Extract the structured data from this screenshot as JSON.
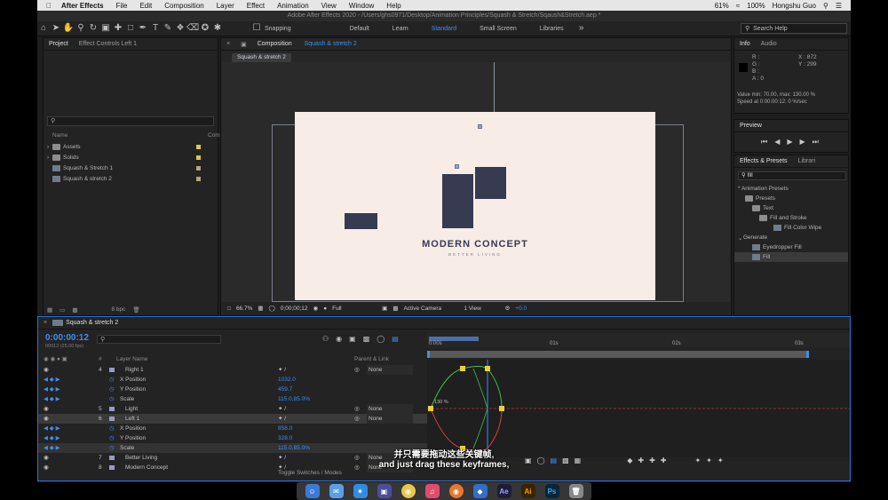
{
  "menubar": {
    "app": "After Effects",
    "items": [
      "File",
      "Edit",
      "Composition",
      "Layer",
      "Effect",
      "Animation",
      "View",
      "Window",
      "Help"
    ],
    "battery": "61%",
    "zoom": "100%",
    "user": "Hongshu Guo"
  },
  "titlebar": {
    "title": "Adobe After Effects 2020 - /Users/ghs0971/Desktop/Animation Principles/Squash & Stretch/Sqaush&Stretch.aep *"
  },
  "toolbar": {
    "snapping": "Snapping",
    "workspaces": [
      "Default",
      "Learn",
      "Standard",
      "Small Screen",
      "Libraries"
    ],
    "active_workspace": "Standard",
    "search_placeholder": "Search Help"
  },
  "project": {
    "tab_project": "Project",
    "tab_effect": "Effect Controls Left 1",
    "col_name": "Name",
    "col_comment": "Comm",
    "items": [
      {
        "name": "Assets",
        "type": "folder",
        "color": "#e0c54a"
      },
      {
        "name": "Solids",
        "type": "folder",
        "color": "#e0c54a"
      },
      {
        "name": "Squash & Stretch 1",
        "type": "comp",
        "color": "#b6a27c"
      },
      {
        "name": "Squash & stretch 2",
        "type": "comp",
        "color": "#b6a27c"
      }
    ],
    "bpc": "8 bpc"
  },
  "composition": {
    "tab_label": "Composition",
    "tab_name": "Squash & stretch 2",
    "breadcrumb": "Squash & stretch 2",
    "brand_title": "MODERN CONCEPT",
    "brand_sub": "BETTER LIVING",
    "zoom": "66.7%",
    "timecode": "0;00;00;12",
    "resolution": "Full",
    "camera": "Active Camera",
    "view": "1 View",
    "exposure": "+0.0"
  },
  "info": {
    "tab_info": "Info",
    "tab_audio": "Audio",
    "r": "R :",
    "g": "G :",
    "b": "B :",
    "a": "A : 0",
    "x": "X : 872",
    "y": "Y : 299",
    "value_line": "Value min: 70.00, max: 130.00 %",
    "speed_line": "Speed at 0:00:00:12: 0 %/sec"
  },
  "preview": {
    "tab": "Preview"
  },
  "effects": {
    "tab": "Effects & Presets",
    "tab2": "Librari",
    "search": "fill",
    "tree": [
      "* Animation Presets",
      "Presets",
      "Text",
      "Fill and Stroke",
      "Fill Color Wipe",
      "Generate",
      "Eyedropper Fill",
      "Fill"
    ]
  },
  "timeline": {
    "tab": "Squash & stretch 2",
    "timecode": "0:00:00:12",
    "fps": "00012 (25.00 fps)",
    "col_num": "#",
    "col_layer": "Layer Name",
    "col_parent": "Parent & Link",
    "rows": [
      {
        "num": "4",
        "name": "Right 1",
        "value": "",
        "parent": "None",
        "kind": "layer"
      },
      {
        "num": "",
        "name": "X Position",
        "value": "1032.0",
        "parent": "",
        "kind": "prop"
      },
      {
        "num": "",
        "name": "Y Position",
        "value": "459.7",
        "parent": "",
        "kind": "prop"
      },
      {
        "num": "",
        "name": "Scale",
        "value": "115.0,85.0%",
        "parent": "",
        "kind": "prop"
      },
      {
        "num": "5",
        "name": "Light",
        "value": "",
        "parent": "None",
        "kind": "layer"
      },
      {
        "num": "6",
        "name": "Left 1",
        "value": "",
        "parent": "None",
        "kind": "layer"
      },
      {
        "num": "",
        "name": "X Position",
        "value": "858.0",
        "parent": "",
        "kind": "prop"
      },
      {
        "num": "",
        "name": "Y Position",
        "value": "328.0",
        "parent": "",
        "kind": "prop"
      },
      {
        "num": "",
        "name": "Scale",
        "value": "115.0,85.0%",
        "parent": "",
        "kind": "prop"
      },
      {
        "num": "7",
        "name": "Better Living",
        "value": "",
        "parent": "None",
        "kind": "layer"
      },
      {
        "num": "8",
        "name": "Modern Concept",
        "value": "",
        "parent": "None",
        "kind": "layer"
      }
    ],
    "ruler": [
      "0:00s",
      "01s",
      "02s",
      "03s"
    ],
    "graph_label": "130 %",
    "toggle": "Toggle Switches / Modes"
  },
  "subtitles": {
    "zh": "并只需要拖动这些关键帧,",
    "en": "and just drag these keyframes,"
  },
  "dock": [
    "Ae",
    "Ai",
    "Ps"
  ]
}
